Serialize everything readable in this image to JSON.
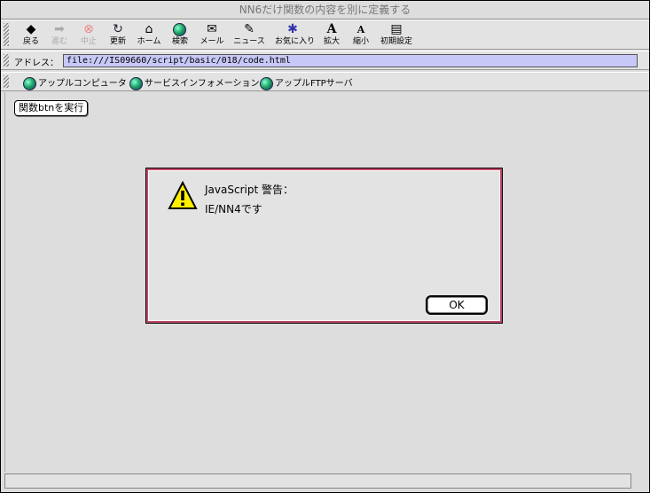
{
  "window": {
    "title": "NN6だけ関数の内容を別に定義する"
  },
  "toolbar": {
    "buttons": [
      {
        "label": "戻る",
        "icon": "back-icon",
        "enabled": true
      },
      {
        "label": "進む",
        "icon": "forward-icon",
        "enabled": false
      },
      {
        "label": "中止",
        "icon": "stop-icon",
        "enabled": false
      },
      {
        "label": "更新",
        "icon": "reload-icon",
        "enabled": true
      },
      {
        "label": "ホーム",
        "icon": "home-icon",
        "enabled": true
      },
      {
        "label": "検索",
        "icon": "search-icon",
        "enabled": true
      },
      {
        "label": "メール",
        "icon": "mail-icon",
        "enabled": true
      },
      {
        "label": "ニュース",
        "icon": "news-icon",
        "enabled": true
      },
      {
        "label": "お気に入り",
        "icon": "favorites-icon",
        "enabled": true
      },
      {
        "label": "拡大",
        "icon": "zoom-in-icon",
        "enabled": true
      },
      {
        "label": "縮小",
        "icon": "zoom-out-icon",
        "enabled": true
      },
      {
        "label": "初期設定",
        "icon": "preferences-icon",
        "enabled": true
      }
    ]
  },
  "address": {
    "label": "アドレス：",
    "url": "file:///IS09660/script/basic/018/code.html"
  },
  "links": [
    {
      "label": "アップルコンピュータ"
    },
    {
      "label": "サービスインフォメーション"
    },
    {
      "label": "アップルFTPサーバ"
    }
  ],
  "page": {
    "button_label": "関数btnを実行"
  },
  "dialog": {
    "title": "JavaScript 警告：",
    "message": "IE/NN4です",
    "ok_label": "OK",
    "border_color": "#c04a6a"
  }
}
